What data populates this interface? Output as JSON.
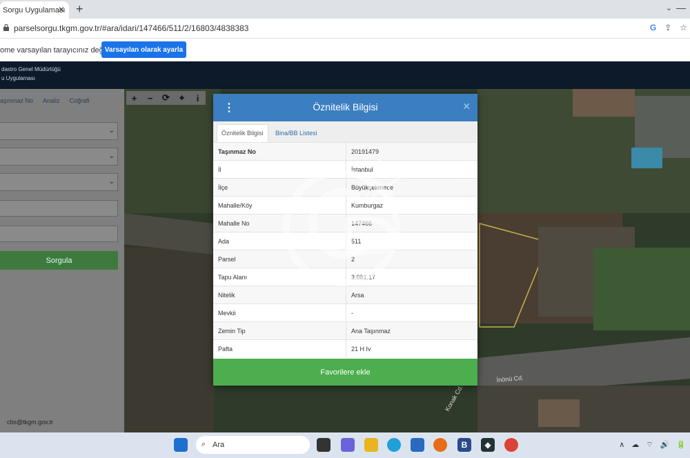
{
  "browser": {
    "tab_title": "Sorgu Uygulaması",
    "tab_close": "✕",
    "new_tab": "+",
    "url": "parselsorgu.tkgm.gov.tr/#ara/idari/147466/511/2/16803/4838383",
    "tab_menu": "⌄",
    "win_min": "—",
    "addr_icons": [
      "G",
      "⇪",
      "☆"
    ]
  },
  "infobar": {
    "message": "ome varsayılan tarayıcınız değil",
    "button": "Varsayılan olarak ayarla"
  },
  "app_header": {
    "line1": "dastro Genel Müdürlüğü",
    "line2": "u Uygulaması"
  },
  "sidebar": {
    "tabs": [
      "aşınmaz No",
      "Analiz",
      "Coğrafi"
    ],
    "query_button": "Sorgula",
    "email": "cbs@tkgm.gov.tr"
  },
  "map_tools": [
    "+",
    "−",
    "⟳",
    "⌖",
    "i"
  ],
  "map_labels": {
    "road1": "İnönü Cd.",
    "road2": "Konak Cd."
  },
  "modal": {
    "title": "Öznitelik Bilgisi",
    "menu_icon": "⋮",
    "close": "✕",
    "tabs": [
      "Öznitelik Bilgisi",
      "Bina/BB Listesi"
    ],
    "rows": [
      {
        "key": "Taşınmaz No",
        "value": "20191479"
      },
      {
        "key": "İl",
        "value": "İstanbul"
      },
      {
        "key": "İlçe",
        "value": "Büyükçekmece"
      },
      {
        "key": "Mahalle/Köy",
        "value": "Kumburgaz"
      },
      {
        "key": "Mahalle No",
        "value": "147466"
      },
      {
        "key": "Ada",
        "value": "511"
      },
      {
        "key": "Parsel",
        "value": "2"
      },
      {
        "key": "Tapu Alanı",
        "value": "3.081,17"
      },
      {
        "key": "Nitelik",
        "value": "Arsa"
      },
      {
        "key": "Mevkii",
        "value": "-"
      },
      {
        "key": "Zemin Tip",
        "value": "Ana Taşınmaz"
      },
      {
        "key": "Pafta",
        "value": "21 H Iv"
      }
    ],
    "favorite_button": "Favorilere ekle"
  },
  "taskbar": {
    "search_placeholder": "Ara",
    "search_icon": "⌕",
    "tray": [
      "∧",
      "☁",
      "⌔",
      "🔊",
      "🔋"
    ]
  }
}
